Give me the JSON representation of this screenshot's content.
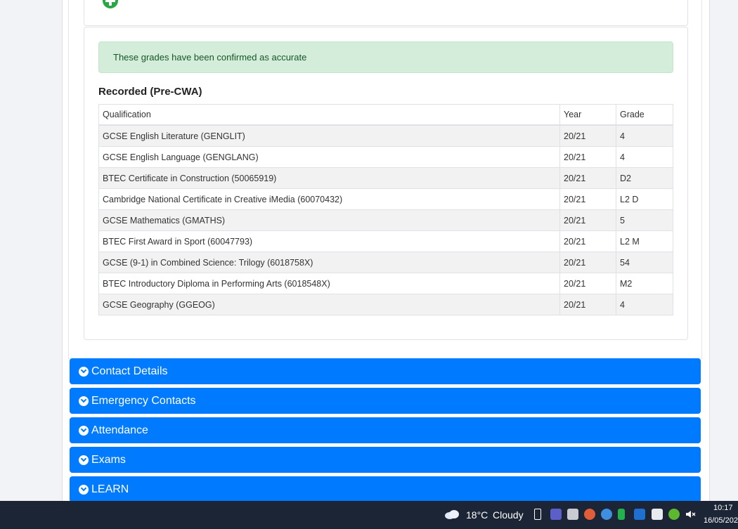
{
  "alert": {
    "text": "These grades have been confirmed as accurate"
  },
  "section": {
    "title": "Recorded (Pre-CWA)"
  },
  "table": {
    "headers": [
      "Qualification",
      "Year",
      "Grade"
    ],
    "rows": [
      [
        "GCSE English Literature (GENGLIT)",
        "20/21",
        "4"
      ],
      [
        "GCSE English Language (GENGLANG)",
        "20/21",
        "4"
      ],
      [
        "BTEC Certificate in Construction (50065919)",
        "20/21",
        "D2"
      ],
      [
        "Cambridge National Certificate in Creative iMedia (60070432)",
        "20/21",
        "L2 D"
      ],
      [
        "GCSE Mathematics (GMATHS)",
        "20/21",
        "5"
      ],
      [
        "BTEC First Award in Sport (60047793)",
        "20/21",
        "L2 M"
      ],
      [
        "GCSE (9-1) in Combined Science: Trilogy (6018758X)",
        "20/21",
        "54"
      ],
      [
        "BTEC Introductory Diploma in Performing Arts (6018548X)",
        "20/21",
        "M2"
      ],
      [
        "GCSE Geography (GGEOG)",
        "20/21",
        "4"
      ]
    ]
  },
  "accordions": [
    {
      "label": "Contact Details"
    },
    {
      "label": "Emergency Contacts"
    },
    {
      "label": "Attendance"
    },
    {
      "label": "Exams"
    },
    {
      "label": "LEARN"
    }
  ],
  "taskbar": {
    "temperature": "18°C",
    "condition": "Cloudy",
    "time": "10:17",
    "date": "16/05/202"
  },
  "colors": {
    "accordion": "#007bff",
    "alert_bg": "#d4edda",
    "add_icon": "#28a745",
    "taskbar": "#1c2535"
  }
}
